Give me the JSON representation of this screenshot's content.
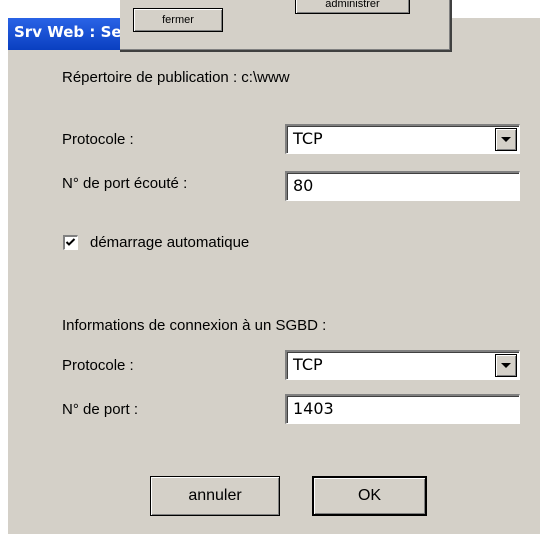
{
  "window": {
    "title": "Srv Web : Se"
  },
  "overlay": {
    "fermer_label": "fermer",
    "administrer_label": "administrer"
  },
  "form": {
    "publication_label": "Répertoire de publication : c:\\www",
    "protocol_label": "Protocole :",
    "protocol_value": "TCP",
    "port_label": "N° de port écouté :",
    "port_value": "80",
    "autostart_label": "démarrage automatique",
    "autostart_checked": true,
    "db_section_label": "Informations de connexion à un SGBD :",
    "db_protocol_label": "Protocole :",
    "db_protocol_value": "TCP",
    "db_port_label": "N° de port  :",
    "db_port_value": "1403"
  },
  "buttons": {
    "cancel_label": "annuler",
    "ok_label": "OK"
  },
  "icons": {
    "dropdown": "chevron-down-icon",
    "check": "checkmark-icon"
  }
}
